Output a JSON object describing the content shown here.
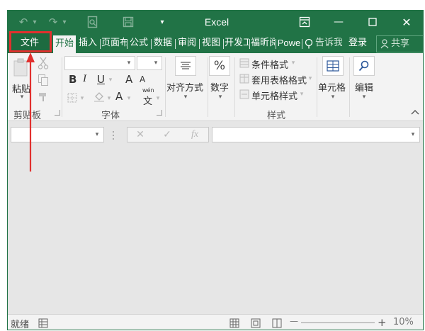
{
  "titlebar": {
    "title": "Excel",
    "undo": "↶",
    "redo": "↷",
    "caret": "▾",
    "minimize": "—",
    "close": "✕"
  },
  "tabs": {
    "file": "文件",
    "items": [
      "开始",
      "插入",
      "页面布",
      "公式",
      "数据",
      "审阅",
      "视图",
      "开发工",
      "福昕阅",
      "Powe"
    ],
    "tell_me": "告诉我",
    "login": "登录",
    "share": "共享"
  },
  "ribbon": {
    "clipboard": {
      "paste": "粘贴",
      "label": "剪贴板"
    },
    "font": {
      "bold": "B",
      "italic": "I",
      "underline": "U",
      "grow": "A",
      "shrink": "A",
      "color": "A",
      "wen": "wén",
      "wen_char": "文",
      "label": "字体"
    },
    "alignment": {
      "label": "对齐方式"
    },
    "number": {
      "icon": "%",
      "label": "数字"
    },
    "styles": {
      "conditional": "条件格式",
      "table": "套用表格格式",
      "cell": "单元格样式",
      "label": "样式"
    },
    "cells": {
      "label": "单元格"
    },
    "editing": {
      "label": "编辑"
    }
  },
  "formula_bar": {
    "cancel": "✕",
    "enter": "✓",
    "fx": "fx"
  },
  "status": {
    "ready": "就绪",
    "zoom": "10%",
    "minus": "—",
    "plus": "+"
  },
  "colors": {
    "accent": "#217346",
    "highlight": "#e1302e"
  }
}
